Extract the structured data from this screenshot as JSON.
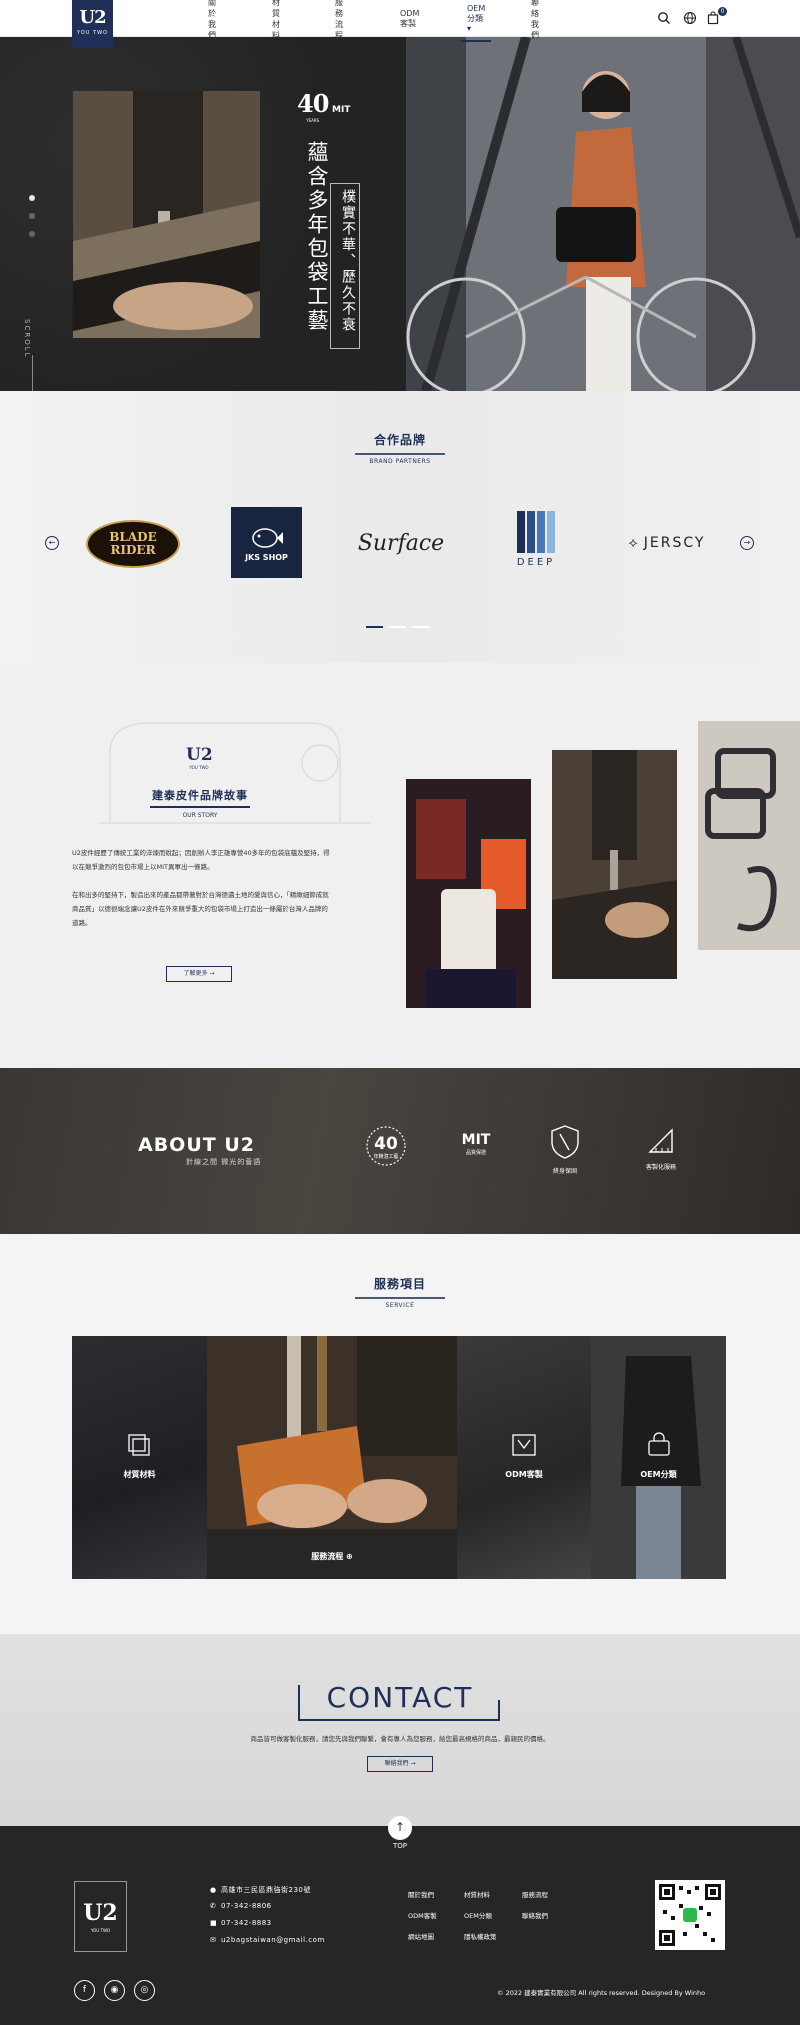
{
  "header": {
    "logo_text": "U2",
    "logo_sub": "YOU TWO",
    "nav": [
      "關於我們",
      "材質材料",
      "服務流程",
      "ODM客製",
      "OEM分類",
      "聯絡我們"
    ],
    "cart_count": "0"
  },
  "hero": {
    "badge_num": "40",
    "badge_mit": "MIT",
    "badge_years": "YEARS",
    "title": "蘊含多年包袋工藝",
    "subtitle": "樸實不華、歷久不衰",
    "scroll": "SCROLL"
  },
  "partners": {
    "title_zh": "合作品牌",
    "title_en": "BRAND PARTNERS",
    "brands": {
      "blade": "BLADE RIDER",
      "jks": "JKS SHOP",
      "surface": "Surface",
      "deep": "DEEP",
      "jersey": "JERSCY"
    }
  },
  "story": {
    "logo_text": "U2",
    "logo_sub": "YOU TWO",
    "title_zh": "建泰皮件品牌故事",
    "title_en": "OUR STORY",
    "p1": "U2皮件經歷了傳統工業的淬煉而蛻起；因創辦人李正雄專營40多年的包袋底蘊及堅持，得以在競爭激烈的包包市場上以MIT異軍出一條路。",
    "p2": "在和出多的堅持下，製造出來的產品都帶著對於台灣德邁土地的愛與信心，「精緻細節成就商品質」以德很端念讓U2皮件在外來競爭重大的包袋市場上打造出一條屬於台灣人品牌的道路。",
    "more": "了解更多"
  },
  "about": {
    "title": "ABOUT U2",
    "subtitle": "針線之間 微光的薈語",
    "features": [
      {
        "big": "40",
        "label": "年精湛工藝"
      },
      {
        "big": "MIT",
        "label": "品質保證"
      },
      {
        "big": "",
        "label": "終身保固"
      },
      {
        "big": "",
        "label": "客製化服務"
      }
    ]
  },
  "service": {
    "title_zh": "服務項目",
    "title_en": "SERVICE",
    "items": [
      "材質材料",
      "服務流程",
      "ODM客製",
      "OEM分類"
    ]
  },
  "contact": {
    "title": "CONTACT",
    "desc": "商品皆可做客製化服務，請您先與我們聯繫，會有專人為您服務，給您最高規格的商品，最親民的價格。",
    "button": "聯絡我們"
  },
  "footer": {
    "top": "TOP",
    "logo_text": "U2",
    "logo_sub": "YOU TWO",
    "address": "高雄市三民區鼎強街230號",
    "phone1": "07-342-8806",
    "phone2": "07-342-8883",
    "email": "u2bagstaiwan@gmail.com",
    "links": [
      "關於我們",
      "材質材料",
      "服務流程",
      "ODM客製",
      "OEM分類",
      "聯絡我們",
      "網站地圖",
      "隱私權政策"
    ],
    "copyright": "© 2022 建泰實業有限公司 All rights reserved. Designed By Winho"
  }
}
